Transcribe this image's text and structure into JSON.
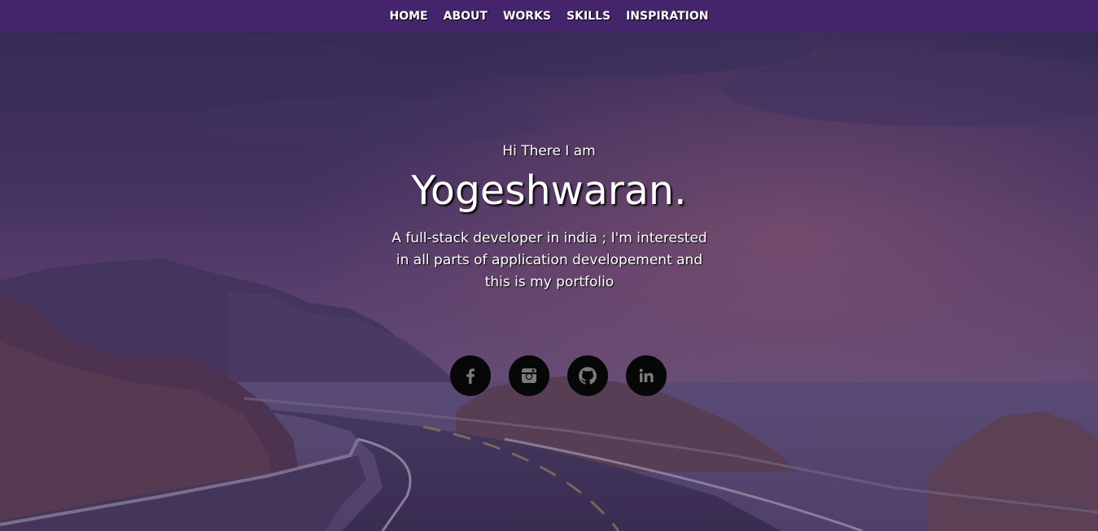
{
  "nav": {
    "items": [
      {
        "label": "HOME"
      },
      {
        "label": "ABOUT"
      },
      {
        "label": "WORKS"
      },
      {
        "label": "SKILLS"
      },
      {
        "label": "INSPIRATION"
      }
    ]
  },
  "hero": {
    "greeting": "Hi There I am",
    "name": "Yogeshwaran.",
    "tagline": "A full-stack developer in india ; I'm interested in all parts of application developement and this is my portfolio"
  },
  "socials": [
    {
      "icon": "facebook-icon"
    },
    {
      "icon": "instagram-icon"
    },
    {
      "icon": "github-icon"
    },
    {
      "icon": "linkedin-icon"
    }
  ],
  "colors": {
    "navbar": "#44246b",
    "overlay": "#3a2460",
    "social_bg": "#070707",
    "icon": "#7a7a7a",
    "text": "#ffffff"
  }
}
